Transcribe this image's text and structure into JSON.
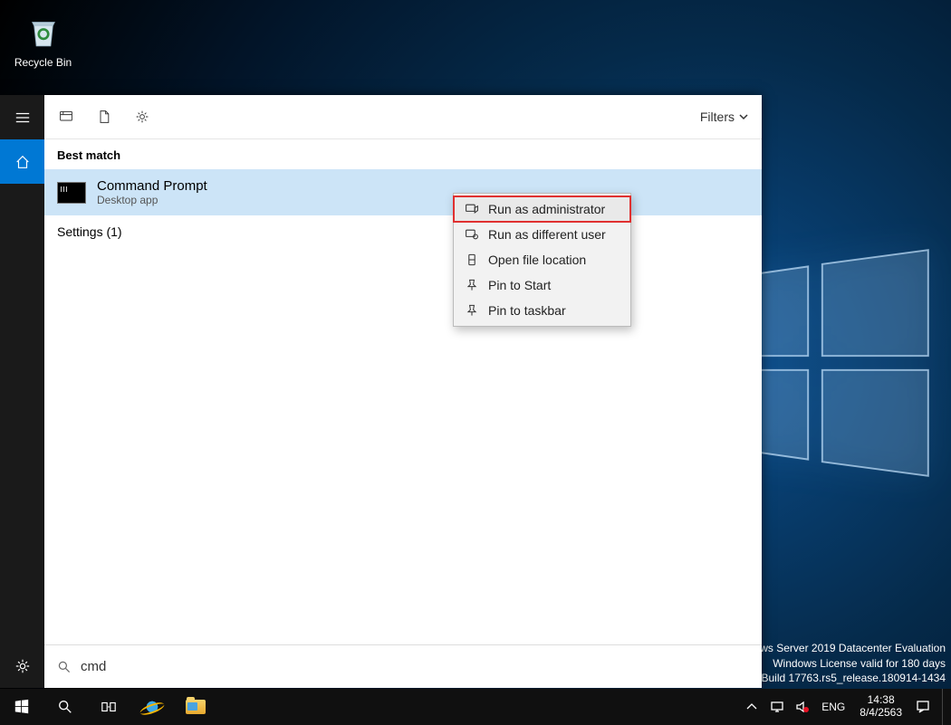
{
  "desktop": {
    "recycle_bin_label": "Recycle Bin"
  },
  "search_panel": {
    "filters_label": "Filters",
    "best_match_label": "Best match",
    "result": {
      "title": "Command Prompt",
      "subtitle": "Desktop app"
    },
    "settings_label": "Settings (1)",
    "search_value": "cmd"
  },
  "context_menu": {
    "items": [
      "Run as administrator",
      "Run as different user",
      "Open file location",
      "Pin to Start",
      "Pin to taskbar"
    ]
  },
  "watermark": {
    "line1": "ows Server 2019 Datacenter Evaluation",
    "line2": "Windows License valid for 180 days",
    "line3": "Build 17763.rs5_release.180914-1434"
  },
  "tray": {
    "lang": "ENG",
    "time": "14:38",
    "date": "8/4/2563"
  }
}
